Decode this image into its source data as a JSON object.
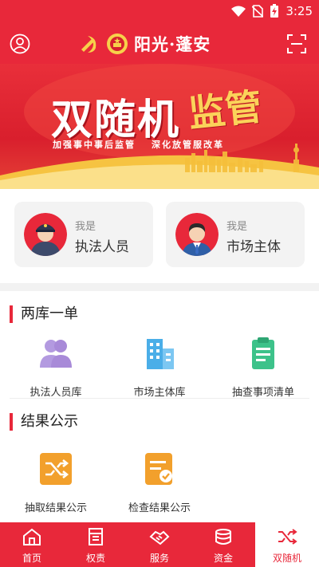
{
  "status": {
    "time": "3:25"
  },
  "header": {
    "title": "阳光·蓬安"
  },
  "banner": {
    "title": "双随机",
    "script": "监管",
    "sub_left": "加强事中事后监管",
    "sub_right": "深化放管服改革"
  },
  "identity": {
    "prefix": "我是",
    "law_enforcer": "执法人员",
    "market_entity": "市场主体"
  },
  "section1": {
    "title": "两库一单",
    "items": [
      {
        "label": "执法人员库",
        "icon": "people-icon"
      },
      {
        "label": "市场主体库",
        "icon": "buildings-icon"
      },
      {
        "label": "抽查事项清单",
        "icon": "clipboard-icon"
      }
    ]
  },
  "section2": {
    "title": "结果公示",
    "items": [
      {
        "label": "抽取结果公示",
        "icon": "shuffle-icon"
      },
      {
        "label": "检查结果公示",
        "icon": "checklist-icon"
      }
    ]
  },
  "tabs": [
    {
      "label": "首页",
      "icon": "home-icon"
    },
    {
      "label": "权责",
      "icon": "book-icon"
    },
    {
      "label": "服务",
      "icon": "handshake-icon"
    },
    {
      "label": "资金",
      "icon": "money-icon"
    },
    {
      "label": "双随机",
      "icon": "shuffle-icon",
      "active": true
    }
  ],
  "colors": {
    "primary": "#e8283a",
    "people": "#a88ad8",
    "buildings": "#4aaee8",
    "clipboard": "#3dc28a",
    "orange": "#f2a02c"
  }
}
